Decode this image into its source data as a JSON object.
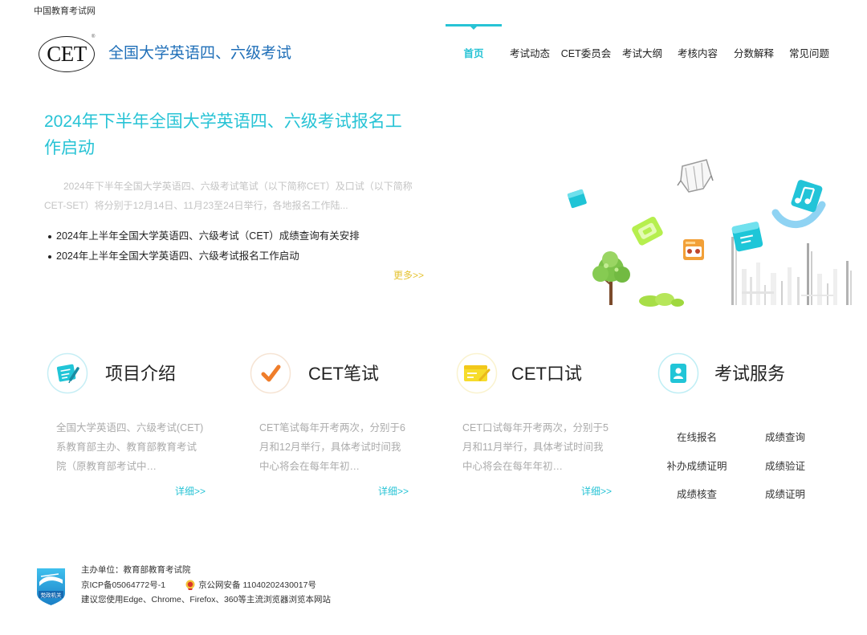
{
  "site": {
    "top_link": "中国教育考试网"
  },
  "header": {
    "logo_text": "CET",
    "logo_mark": "®",
    "title": "全国大学英语四、六级考试",
    "nav": [
      {
        "label": "首页",
        "active": true
      },
      {
        "label": "考试动态",
        "active": false
      },
      {
        "label": "CET委员会",
        "active": false
      },
      {
        "label": "考试大纲",
        "active": false
      },
      {
        "label": "考核内容",
        "active": false
      },
      {
        "label": "分数解释",
        "active": false
      },
      {
        "label": "常见问题",
        "active": false
      }
    ]
  },
  "hero": {
    "headline": "2024年下半年全国大学英语四、六级考试报名工作启动",
    "summary": "2024年下半年全国大学英语四、六级考试笔试（以下简称CET）及口试（以下简称CET-SET）将分别于12月14日、11月23至24日举行，各地报名工作陆...",
    "news": [
      "2024年上半年全国大学英语四、六级考试（CET）成绩查询有关安排",
      "2024年上半年全国大学英语四、六级考试报名工作启动"
    ],
    "more": "更多>>",
    "illustration_icons": [
      "cube-icon",
      "graduation-bag-icon",
      "ticket-icon",
      "radio-icon",
      "book-icon",
      "music-note-icon",
      "tree-icon",
      "bush-icon",
      "building-lines"
    ]
  },
  "cards": [
    {
      "icon": "note-pen-icon",
      "title": "项目介绍",
      "desc": "全国大学英语四、六级考试(CET)系教育部主办、教育部教育考试院（原教育部考试中…",
      "more": "详细>>"
    },
    {
      "icon": "check-icon",
      "title": "CET笔试",
      "desc": "CET笔试每年开考两次，分别于6月和12月举行，具体考试时间我中心将会在每年年初…",
      "more": "详细>>"
    },
    {
      "icon": "card-pen-icon",
      "title": "CET口试",
      "desc": "CET口试每年开考两次，分别于5月和11月举行，具体考试时间我中心将会在每年年初…",
      "more": "详细>>"
    },
    {
      "icon": "id-card-icon",
      "title": "考试服务",
      "links": [
        "在线报名",
        "成绩查询",
        "补办成绩证明",
        "成绩验证",
        "成绩核查",
        "成绩证明"
      ]
    }
  ],
  "footer": {
    "badge_text": "党政机关",
    "sponsor": "主办单位：教育部教育考试院",
    "icp": "京ICP备05064772号-1",
    "police": "京公网安备 11040202430017号",
    "browser_tip": "建议您使用Edge、Chrome、Firefox、360等主流浏览器浏览本网站"
  },
  "colors": {
    "accent": "#27c3d5",
    "title_blue": "#1f6fb8",
    "more_yellow": "#e5c332",
    "text": "#333333",
    "muted": "#c4c4c4"
  }
}
